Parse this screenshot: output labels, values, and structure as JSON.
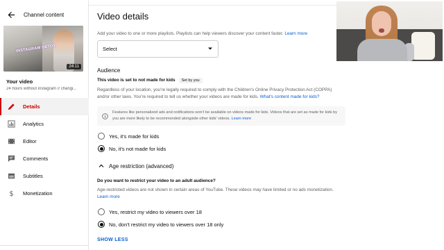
{
  "sidebar": {
    "title": "Channel content",
    "thumbnail": {
      "caption": "INSTAGRAM DETOX",
      "duration": "24:11"
    },
    "your_video_label": "Your video",
    "video_subtitle": "24 hours without instagram // changi...",
    "nav": [
      {
        "label": "Details",
        "icon": "pencil-icon",
        "active": true
      },
      {
        "label": "Analytics",
        "icon": "analytics-icon",
        "active": false
      },
      {
        "label": "Editor",
        "icon": "editor-icon",
        "active": false
      },
      {
        "label": "Comments",
        "icon": "comments-icon",
        "active": false
      },
      {
        "label": "Subtitles",
        "icon": "subtitles-icon",
        "active": false
      },
      {
        "label": "Monetization",
        "icon": "dollar-icon",
        "active": false
      }
    ]
  },
  "main": {
    "page_title": "Video details",
    "playlists_text": "Add your video to one or more playlists. Playlists can help viewers discover your content faster.",
    "playlists_link": "Learn more",
    "playlist_select": {
      "value": "Select"
    },
    "audience": {
      "heading": "Audience",
      "status": "This video is set to not made for kids",
      "chip": "Set by you",
      "body": "Regardless of your location, you're legally required to comply with the Children's Online Privacy Protection Act (COPPA) and/or other laws. You're required to tell us whether your videos are made for kids.",
      "body_link": "What's content made for kids?",
      "info": "Features like personalized ads and notifications won't be available on videos made for kids. Videos that are set as made for kids by you are more likely to be recommended alongside other kids' videos.",
      "info_link": "Learn more",
      "options": [
        {
          "label": "Yes, it's made for kids",
          "selected": false
        },
        {
          "label": "No, it's not made for kids",
          "selected": true
        }
      ]
    },
    "age_restriction": {
      "heading": "Age restriction (advanced)",
      "question": "Do you want to restrict your video to an adult audience?",
      "body": "Age-restricted videos are not shown in certain areas of YouTube. These videos may have limited or no ads monetization.",
      "link": "Learn more",
      "options": [
        {
          "label": "Yes, restrict my video to viewers over 18",
          "selected": false
        },
        {
          "label": "No, don't restrict my video to viewers over 18 only",
          "selected": true
        }
      ]
    },
    "show_less": "SHOW LESS"
  },
  "colors": {
    "accent_red": "#cc0000",
    "link_blue": "#065fd4"
  }
}
